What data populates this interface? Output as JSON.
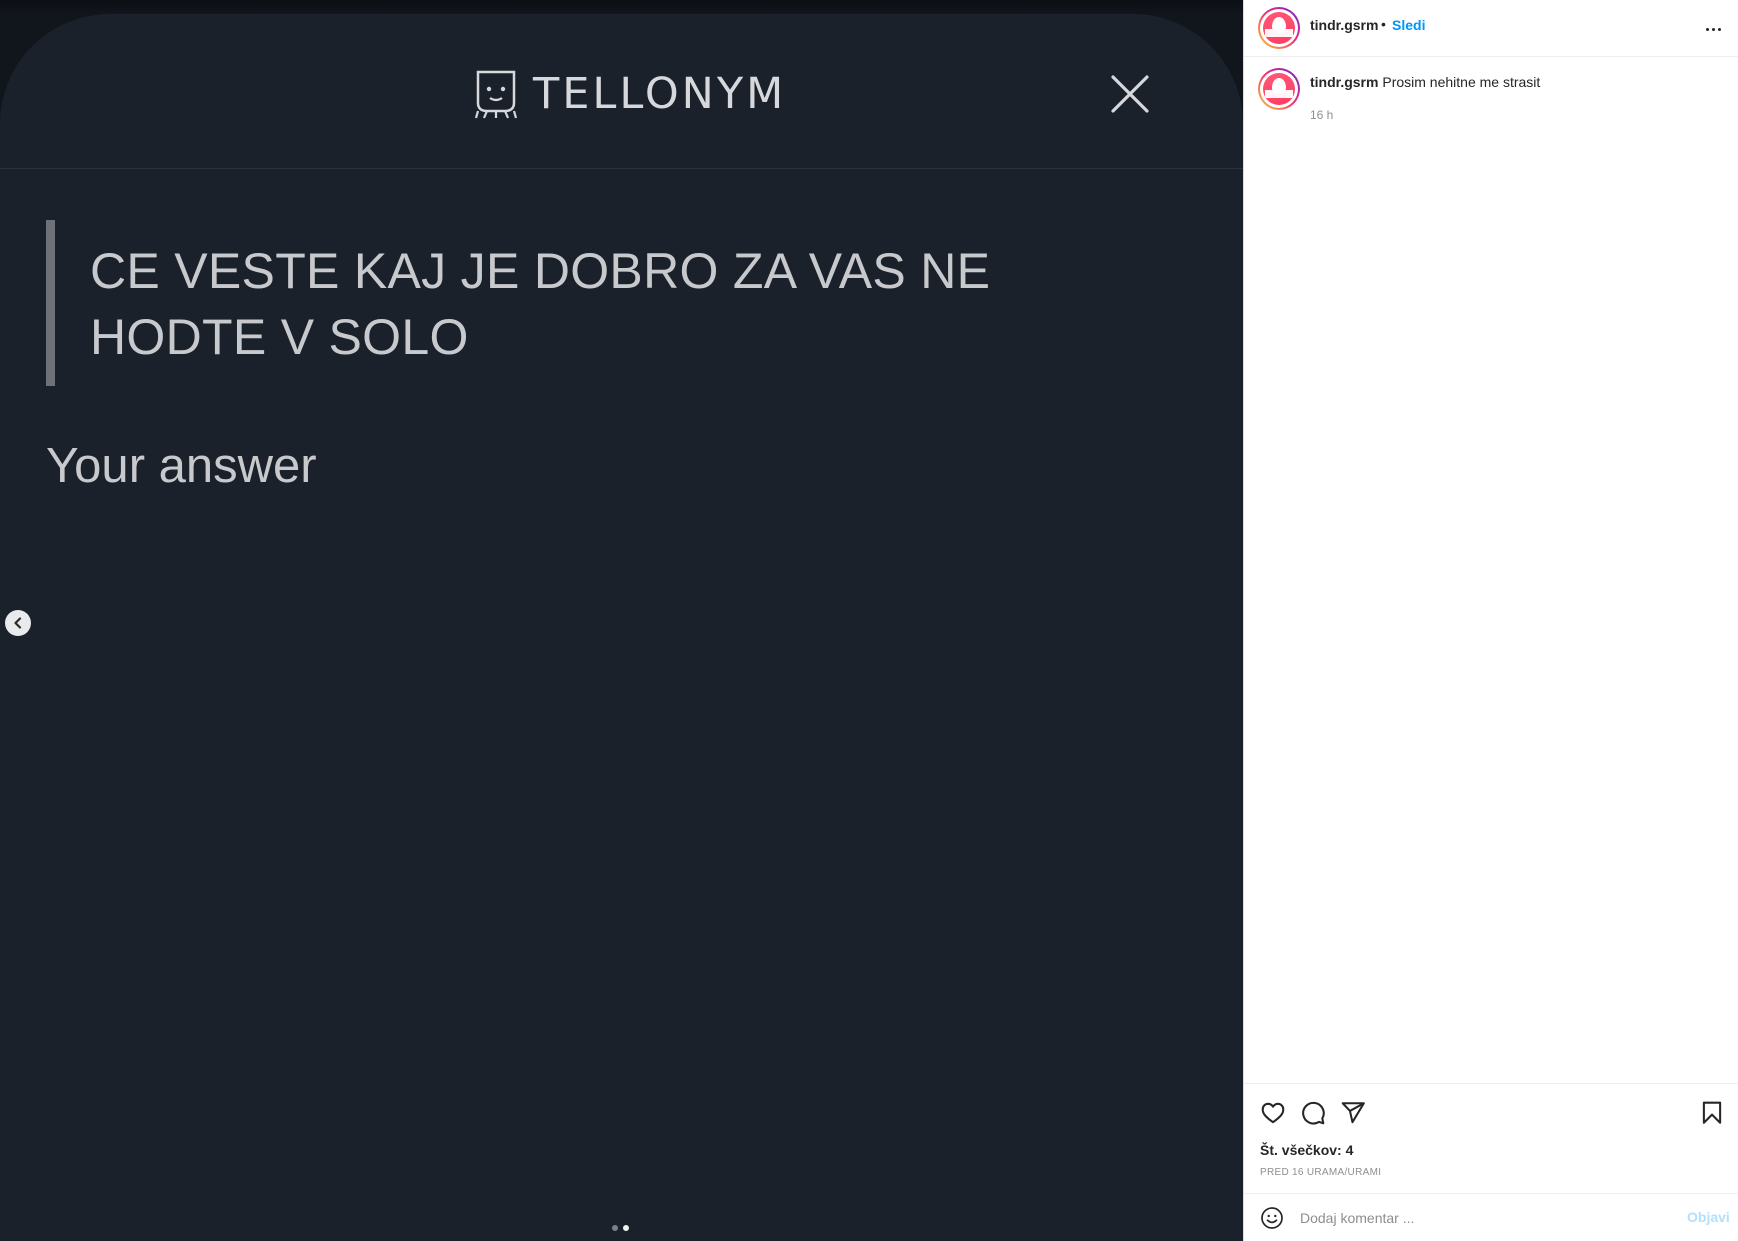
{
  "media": {
    "logo_text": "TELLONYM",
    "question": "CE VESTE KAJ JE DOBRO ZA VAS NE HODTE V SOLO",
    "answer_label": "Your answer",
    "carousel": {
      "slides": 2,
      "active": 2
    }
  },
  "post": {
    "username": "tindr.gsrm",
    "separator": "•",
    "follow_label": "Sledi",
    "caption_user": "tindr.gsrm",
    "caption_text": "Prosim nehitne me strasit",
    "caption_time": "16 h",
    "likes_text": "Št. všečkov: 4",
    "date_text": "PRED 16 URAMA/URAMI",
    "comment_placeholder": "Dodaj komentar ...",
    "post_label": "Objavi"
  },
  "colors": {
    "follow": "#0095f6",
    "post_disabled": "#b2dffc",
    "media_bg": "#1b212b",
    "question_text": "#c7c9cd"
  },
  "icons": [
    "close-icon",
    "tellonym-logo-icon",
    "chevron-left-icon",
    "more-icon",
    "heart-icon",
    "comment-icon",
    "share-icon",
    "bookmark-icon",
    "emoji-icon"
  ]
}
